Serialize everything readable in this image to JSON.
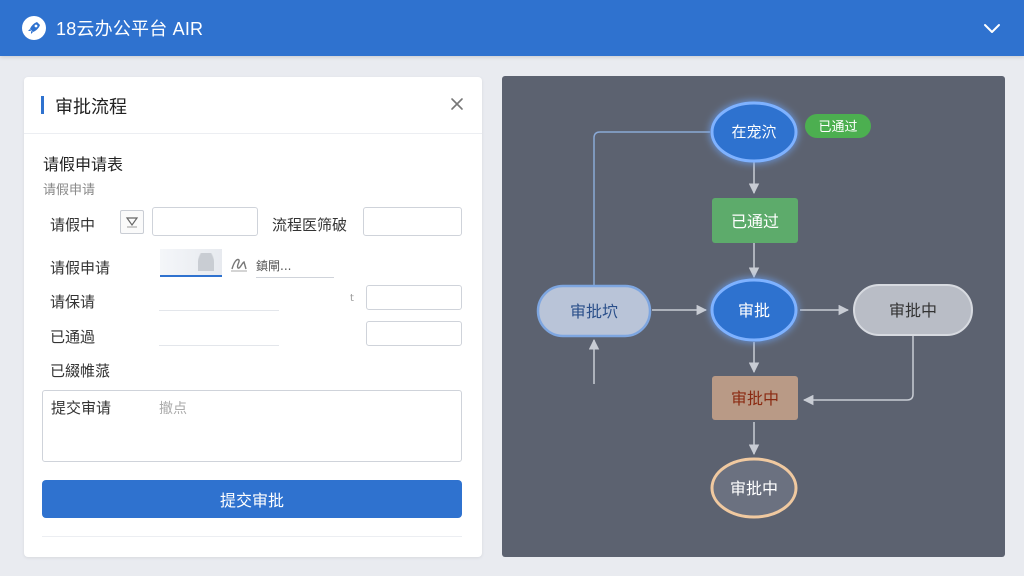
{
  "app": {
    "title": "18云办公平台 AIR"
  },
  "panel": {
    "title": "审批流程",
    "form_title": "请假申请表",
    "form_subtitle": "请假申请",
    "labels": {
      "row1": "请假中",
      "row1_right": "流程医筛破",
      "row2": "请假申请",
      "row2_link": "鎮閘...",
      "row3": "请保请",
      "row3_mark": "t",
      "row4": "已通過",
      "row5": "已綴帷蒎",
      "textarea_label": "提交审请",
      "textarea_placeholder": "撤点"
    },
    "submit_label": "提交审批"
  },
  "flow": {
    "nodes": {
      "top": "在宠泬",
      "top_badge": "已通过",
      "passed": "已通过",
      "left": "审批坹",
      "center": "审批",
      "right": "审批中",
      "pending": "审批中",
      "bottom": "审批中"
    }
  },
  "colors": {
    "brand_blue": "#2f72cf",
    "flow_bg": "#5c6270",
    "green": "#5dab6b",
    "badge_green": "#4caf50",
    "pending_tan": "#b99a86",
    "grey_node": "#b9bdc6"
  }
}
